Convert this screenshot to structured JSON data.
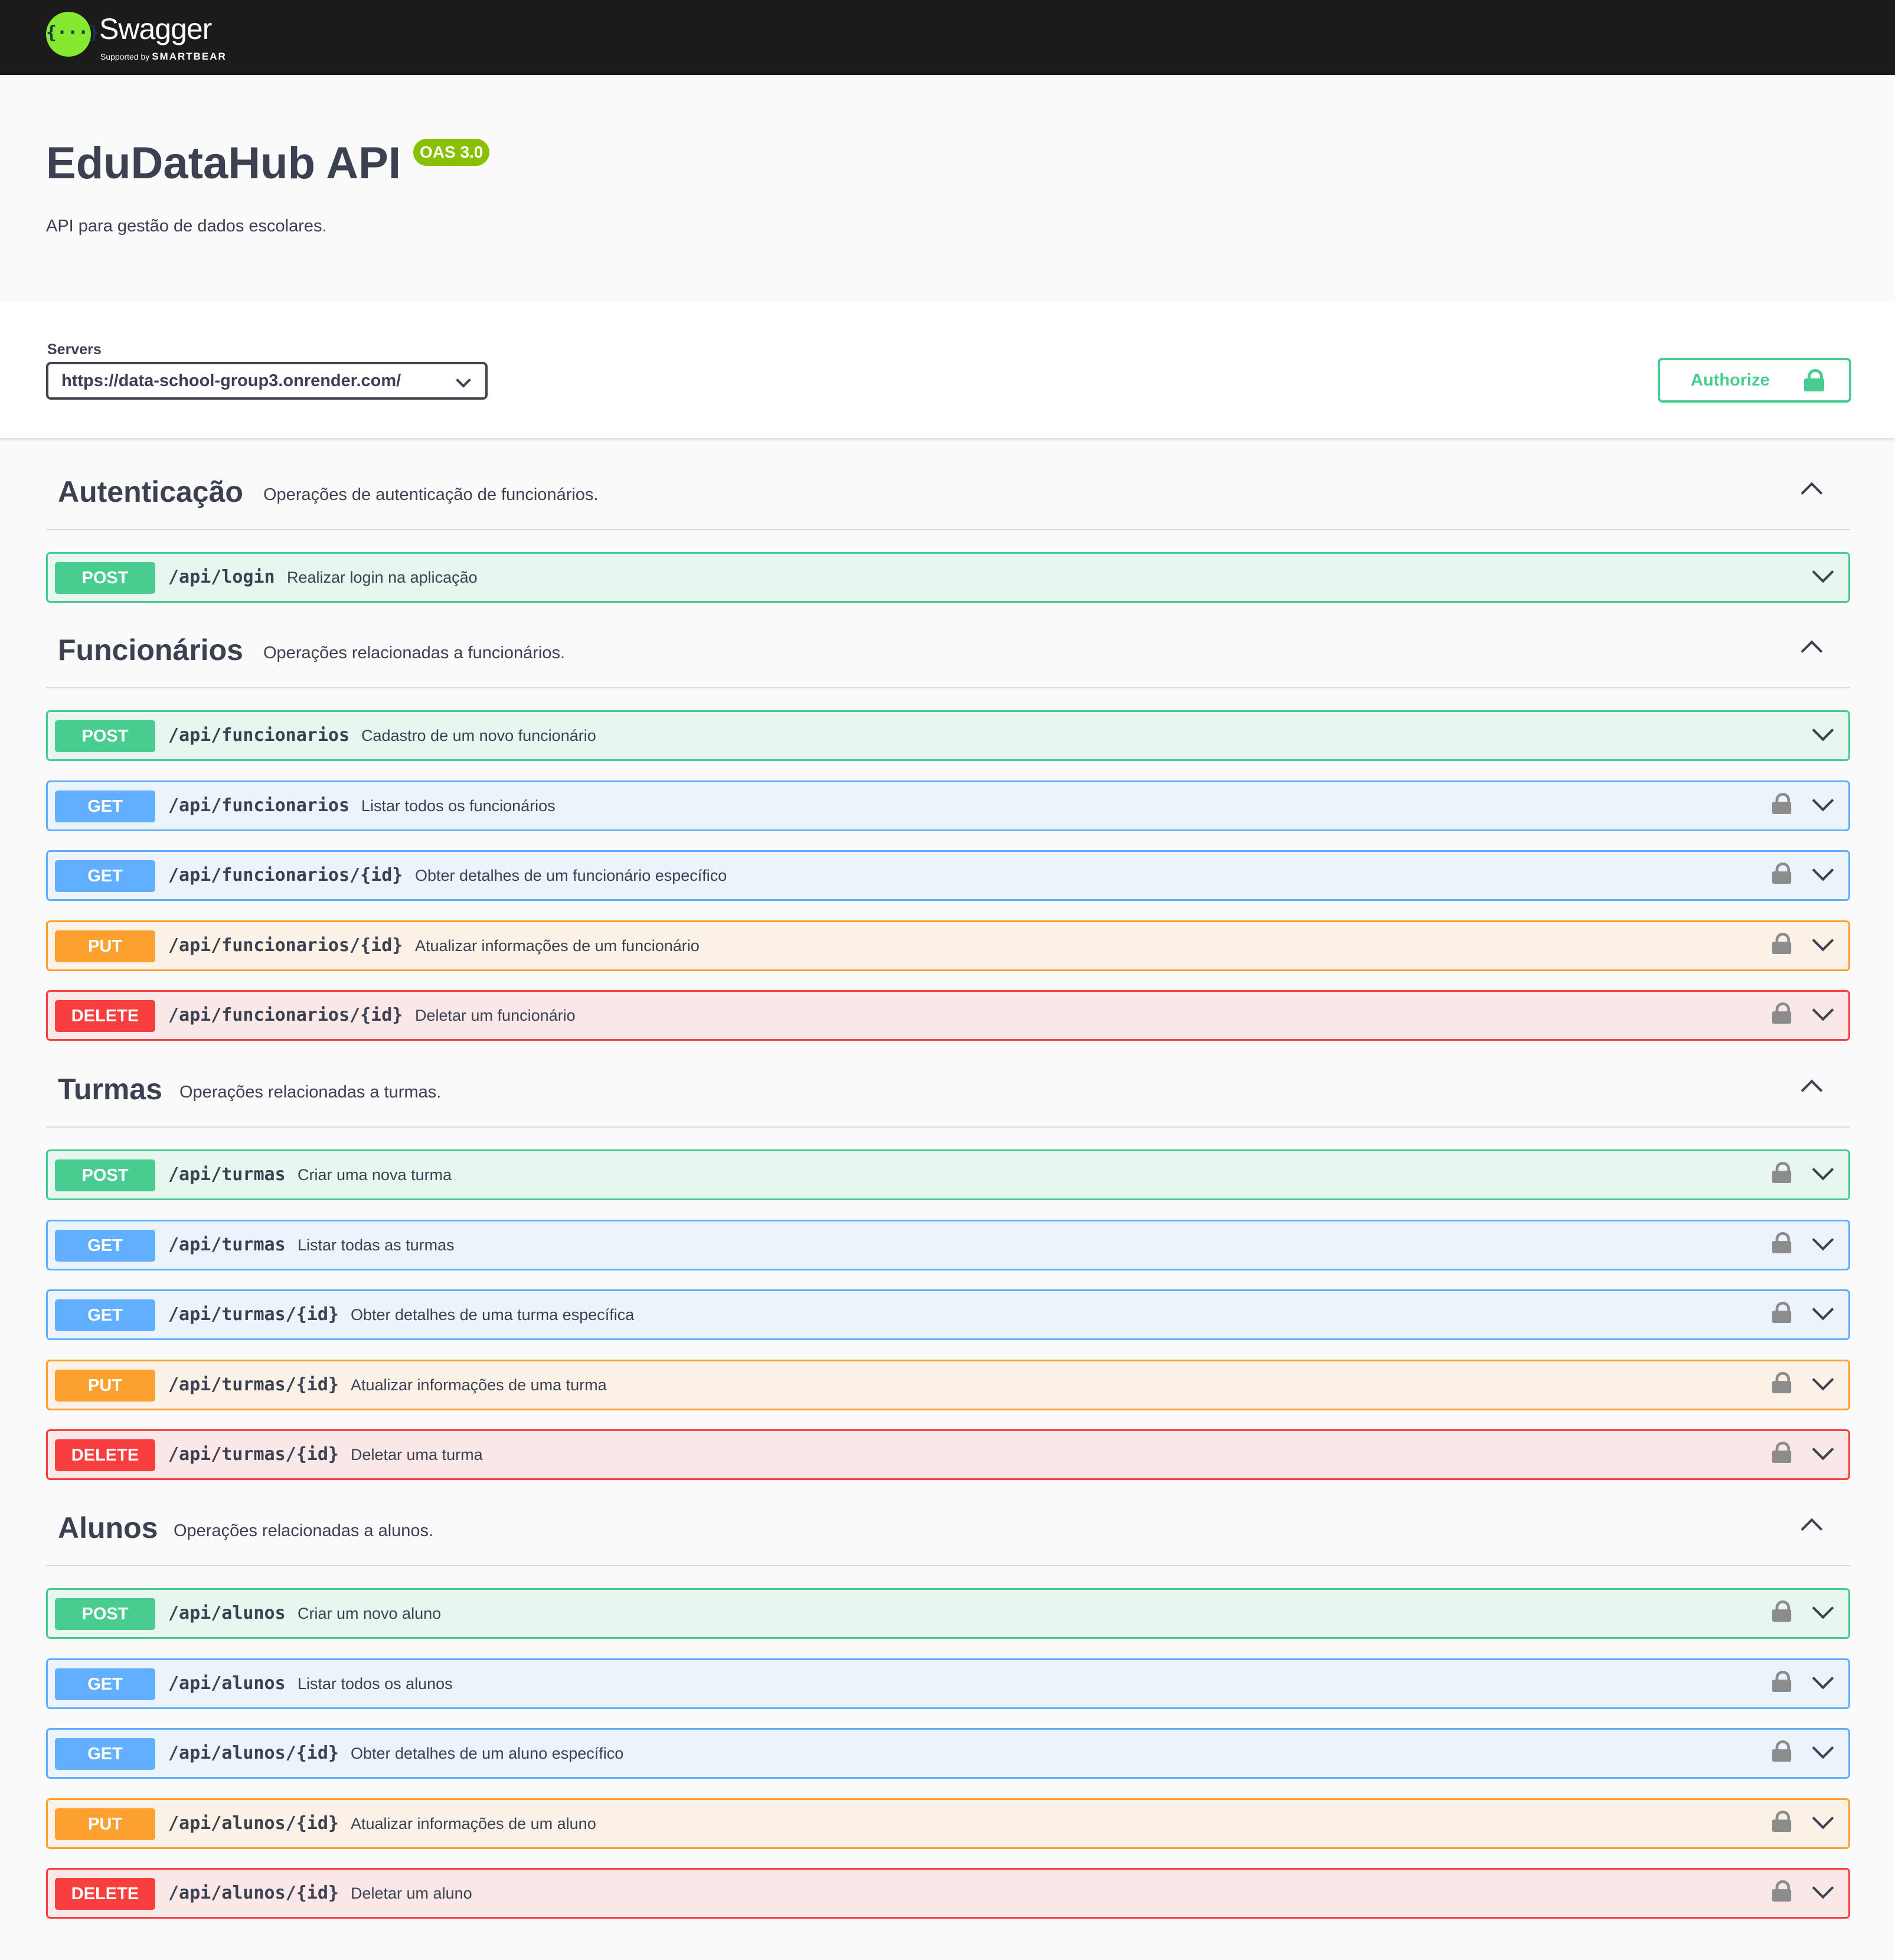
{
  "header": {
    "logo_text": "Swagger",
    "logo_icon_glyph": "{···}",
    "logo_sub_prefix": "Supported by",
    "logo_sub_brand": "SMARTBEAR"
  },
  "info": {
    "title": "EduDataHub API",
    "version_badge": "OAS 3.0",
    "description": "API para gestão de dados escolares."
  },
  "servers": {
    "label": "Servers",
    "selected": "https://data-school-group3.onrender.com/"
  },
  "authorize": {
    "label": "Authorize"
  },
  "colors": {
    "post": "#49cc90",
    "get": "#61affe",
    "put": "#fca130",
    "delete": "#f93e3e",
    "topbar": "#1b1b1b",
    "oas_badge": "#89bf04"
  },
  "tags": [
    {
      "name": "Autenticação",
      "description": "Operações de autenticação de funcionários.",
      "operations": [
        {
          "method": "POST",
          "path": "/api/login",
          "summary": "Realizar login na aplicação",
          "locked": false
        }
      ]
    },
    {
      "name": "Funcionários",
      "description": "Operações relacionadas a funcionários.",
      "operations": [
        {
          "method": "POST",
          "path": "/api/funcionarios",
          "summary": "Cadastro de um novo funcionário",
          "locked": false
        },
        {
          "method": "GET",
          "path": "/api/funcionarios",
          "summary": "Listar todos os funcionários",
          "locked": true
        },
        {
          "method": "GET",
          "path": "/api/funcionarios/{id}",
          "summary": "Obter detalhes de um funcionário específico",
          "locked": true
        },
        {
          "method": "PUT",
          "path": "/api/funcionarios/{id}",
          "summary": "Atualizar informações de um funcionário",
          "locked": true
        },
        {
          "method": "DELETE",
          "path": "/api/funcionarios/{id}",
          "summary": "Deletar um funcionário",
          "locked": true
        }
      ]
    },
    {
      "name": "Turmas",
      "description": "Operações relacionadas a turmas.",
      "operations": [
        {
          "method": "POST",
          "path": "/api/turmas",
          "summary": "Criar uma nova turma",
          "locked": true
        },
        {
          "method": "GET",
          "path": "/api/turmas",
          "summary": "Listar todas as turmas",
          "locked": true
        },
        {
          "method": "GET",
          "path": "/api/turmas/{id}",
          "summary": "Obter detalhes de uma turma específica",
          "locked": true
        },
        {
          "method": "PUT",
          "path": "/api/turmas/{id}",
          "summary": "Atualizar informações de uma turma",
          "locked": true
        },
        {
          "method": "DELETE",
          "path": "/api/turmas/{id}",
          "summary": "Deletar uma turma",
          "locked": true
        }
      ]
    },
    {
      "name": "Alunos",
      "description": "Operações relacionadas a alunos.",
      "operations": [
        {
          "method": "POST",
          "path": "/api/alunos",
          "summary": "Criar um novo aluno",
          "locked": true
        },
        {
          "method": "GET",
          "path": "/api/alunos",
          "summary": "Listar todos os alunos",
          "locked": true
        },
        {
          "method": "GET",
          "path": "/api/alunos/{id}",
          "summary": "Obter detalhes de um aluno específico",
          "locked": true
        },
        {
          "method": "PUT",
          "path": "/api/alunos/{id}",
          "summary": "Atualizar informações de um aluno",
          "locked": true
        },
        {
          "method": "DELETE",
          "path": "/api/alunos/{id}",
          "summary": "Deletar um aluno",
          "locked": true
        }
      ]
    }
  ]
}
